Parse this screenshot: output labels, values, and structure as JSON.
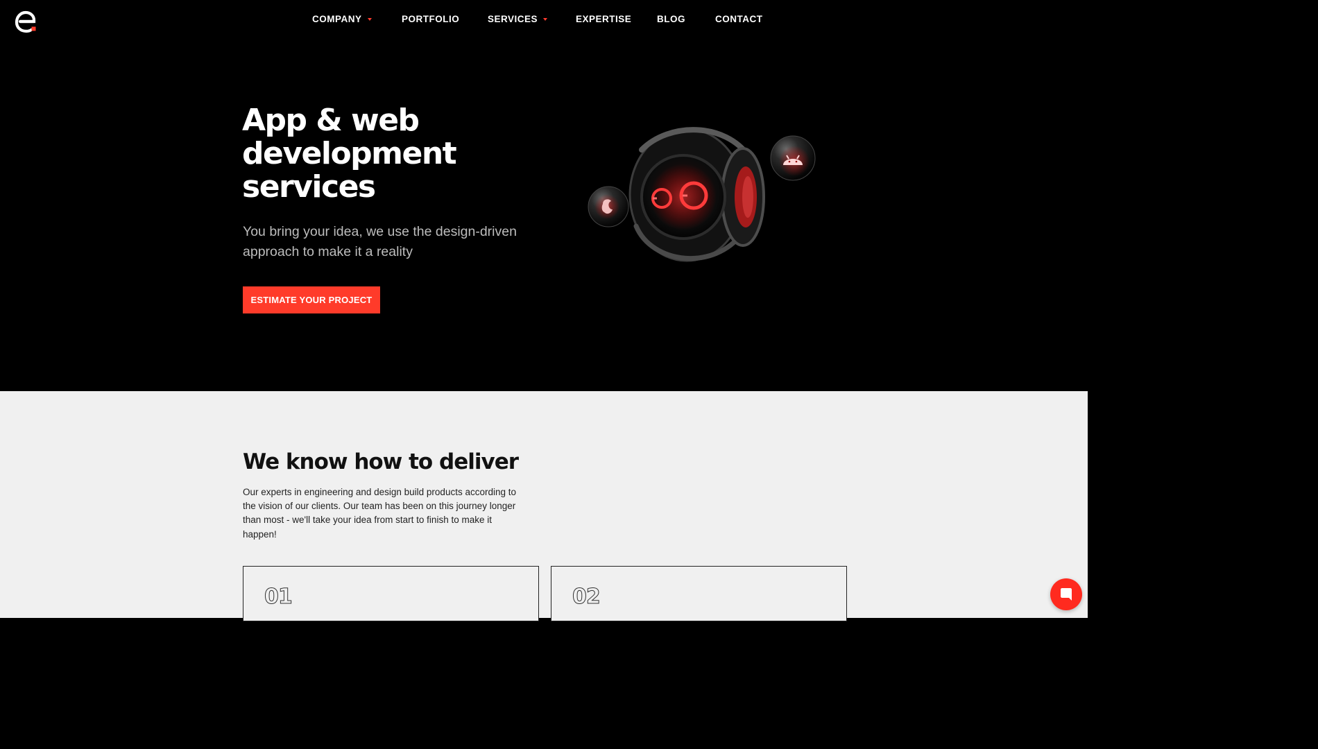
{
  "brand": {
    "logo_icon": "e-logo-icon",
    "accent": "#ff3b2a"
  },
  "nav": {
    "items": [
      {
        "label": "COMPANY",
        "has_dropdown": true
      },
      {
        "label": "PORTFOLIO",
        "has_dropdown": false
      },
      {
        "label": "SERVICES",
        "has_dropdown": true
      },
      {
        "label": "EXPERTISE",
        "has_dropdown": false
      },
      {
        "label": "BLOG",
        "has_dropdown": false
      },
      {
        "label": "CONTACT",
        "has_dropdown": false
      }
    ]
  },
  "hero": {
    "title_lines": [
      "App & web",
      "development",
      "services"
    ],
    "subtitle": "You bring your idea, we use the design-driven approach to make it a reality",
    "cta_label": "ESTIMATE YOUR PROJECT",
    "illustration": "robot-illustration"
  },
  "deliver": {
    "title": "We know how to deliver",
    "text": "Our experts in engineering and design build products according to the vision of our clients. Our team has been on this journey longer than most - we'll take your idea from start to finish to make it happen!",
    "cards": [
      {
        "number": "01"
      },
      {
        "number": "02"
      }
    ]
  },
  "chat": {
    "icon": "chat-icon"
  }
}
